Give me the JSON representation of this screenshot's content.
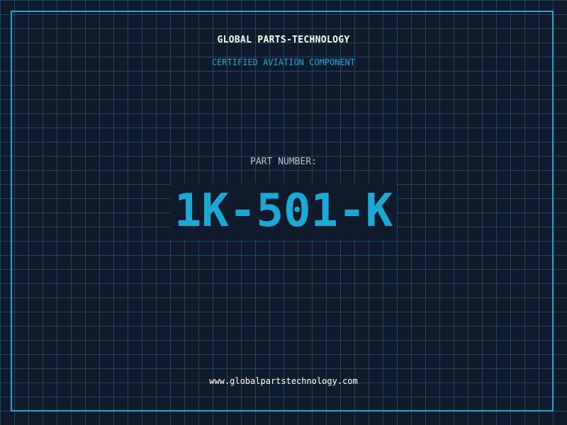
{
  "label": {
    "company": "GLOBAL PARTS-TECHNOLOGY",
    "tagline": "CERTIFIED AVIATION COMPONENT",
    "part_number_label": "PART NUMBER:",
    "part_number": "1K-501-K",
    "website": "www.globalpartstechnology.com"
  },
  "colors": {
    "background": "#0f1a2b",
    "grid": "#246e8c",
    "accent": "#1ba8d4",
    "text_primary": "#ffffff",
    "text_muted": "#b9c3cf"
  }
}
